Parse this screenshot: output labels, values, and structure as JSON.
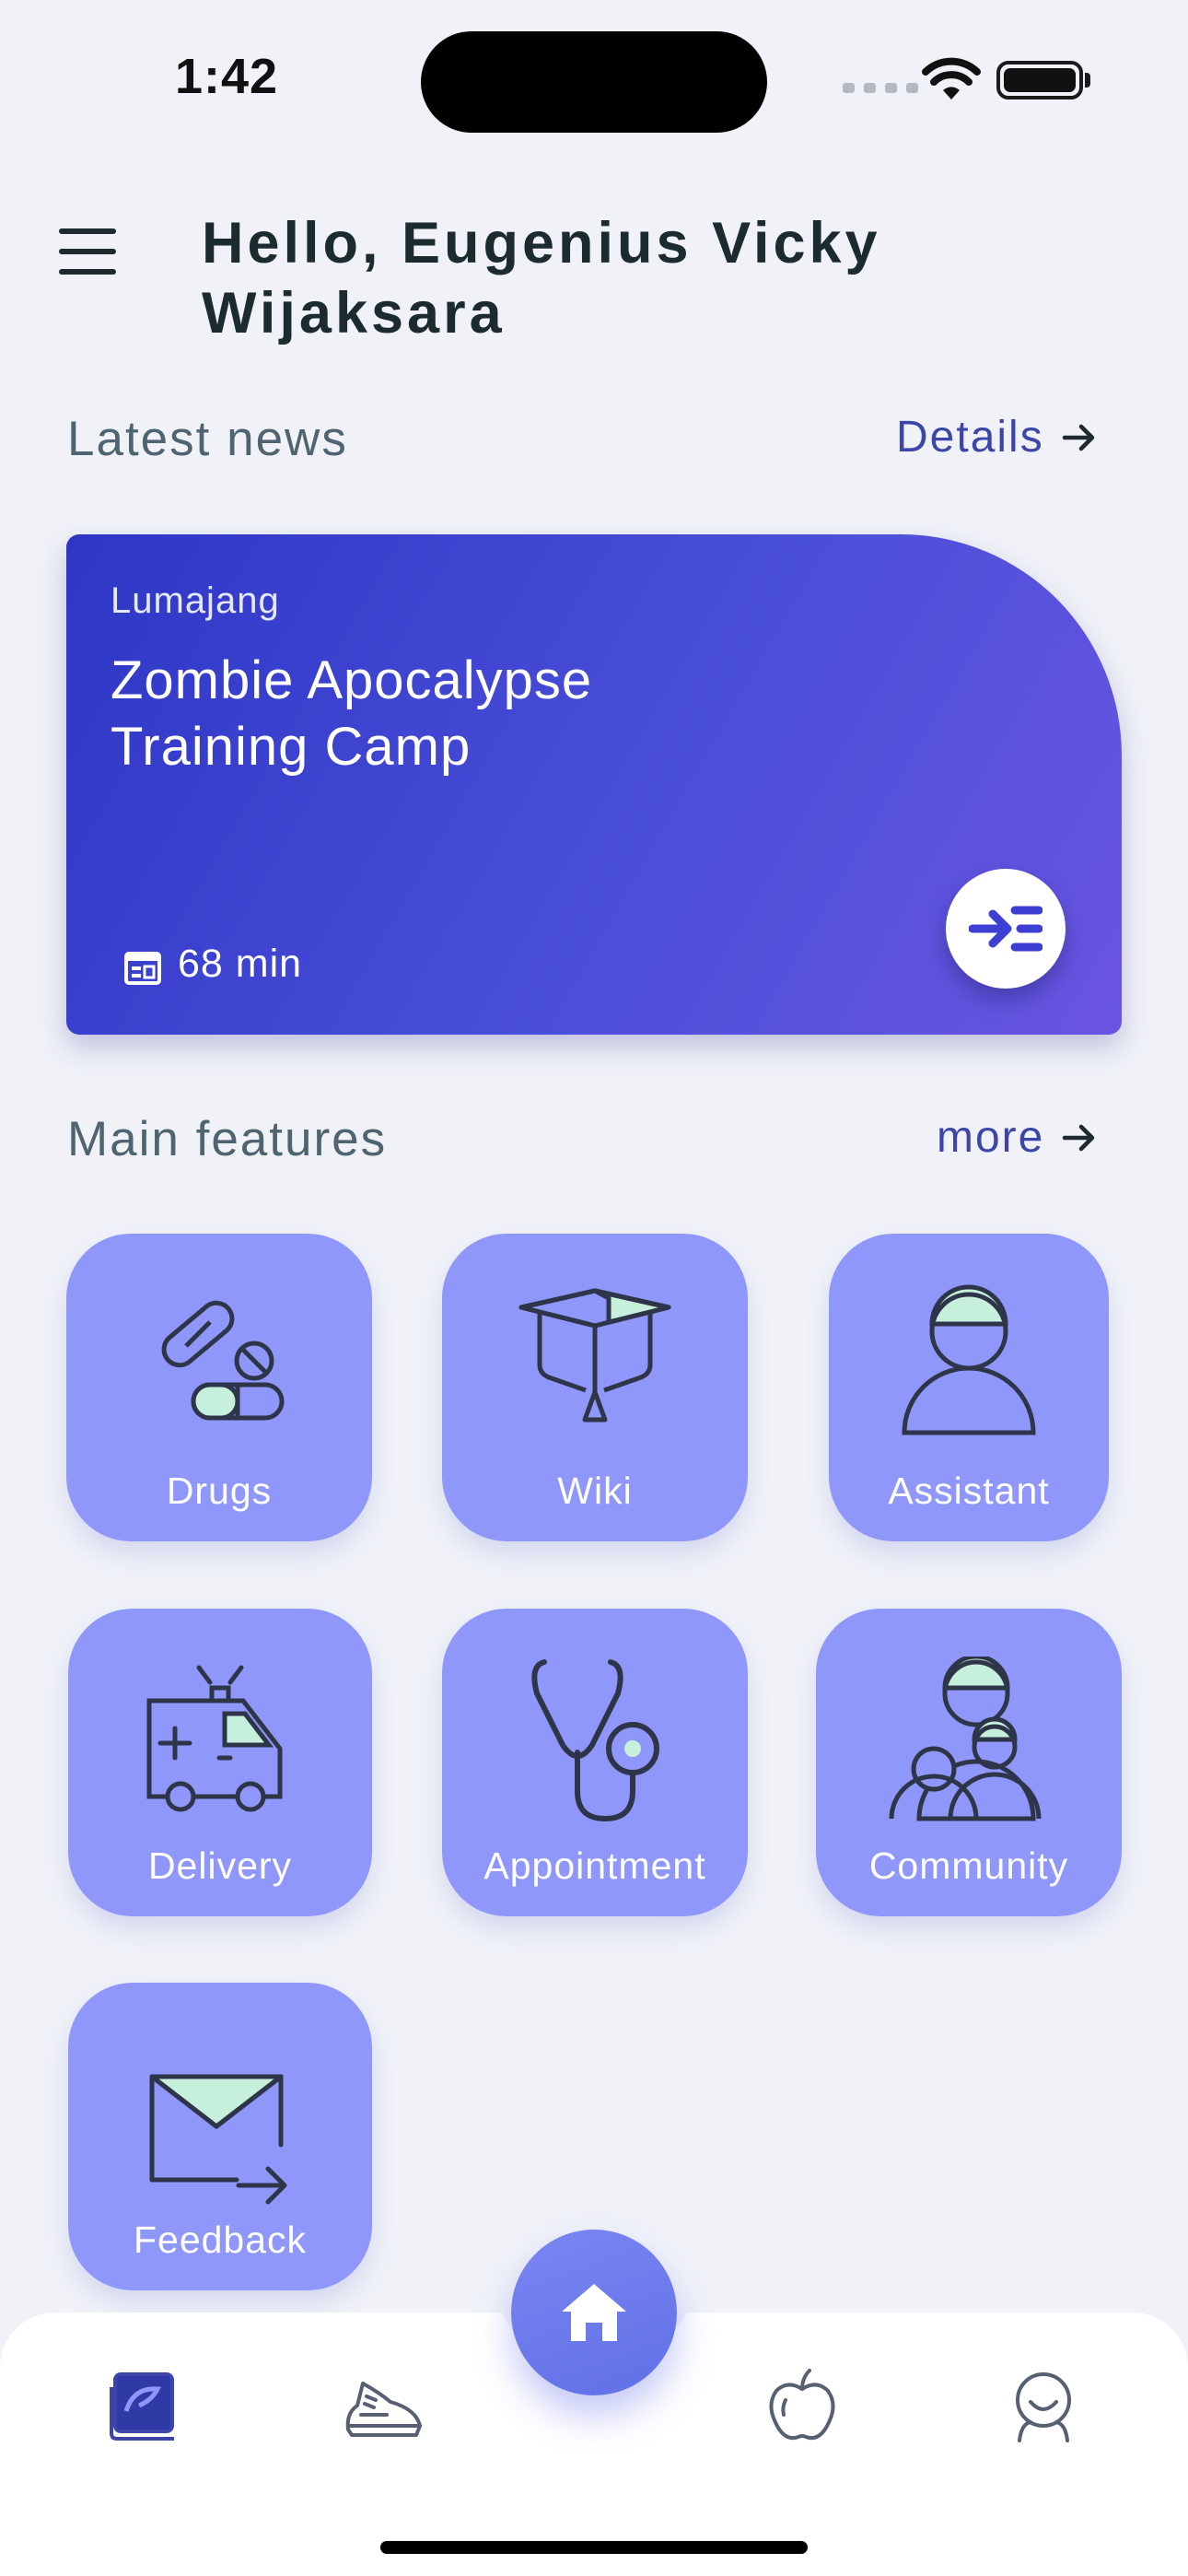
{
  "status_bar": {
    "time": "1:42"
  },
  "header": {
    "greeting": "Hello, Eugenius Vicky Wijaksara"
  },
  "news": {
    "section_title": "Latest news",
    "details_label": "Details",
    "card": {
      "location": "Lumajang",
      "title": "Zombie Apocalypse Training Camp",
      "duration": "68 min"
    }
  },
  "features": {
    "section_title": "Main features",
    "more_label": "more",
    "items": [
      {
        "label": "Drugs",
        "icon": "pills-icon"
      },
      {
        "label": "Wiki",
        "icon": "graduation-cap-icon"
      },
      {
        "label": "Assistant",
        "icon": "person-icon"
      },
      {
        "label": "Delivery",
        "icon": "ambulance-icon"
      },
      {
        "label": "Appointment",
        "icon": "stethoscope-icon"
      },
      {
        "label": "Community",
        "icon": "group-icon"
      },
      {
        "label": "Feedback",
        "icon": "mail-forward-icon"
      }
    ]
  },
  "bottom_nav": {
    "items": [
      "book-icon",
      "sneaker-icon",
      "home-icon",
      "apple-icon",
      "profile-icon"
    ]
  },
  "colors": {
    "accent": "#8f97fb",
    "card_start": "#2e36c6",
    "card_end": "#6a55e2",
    "icon_fill": "#c7f0dc",
    "link": "#3d46a8"
  }
}
